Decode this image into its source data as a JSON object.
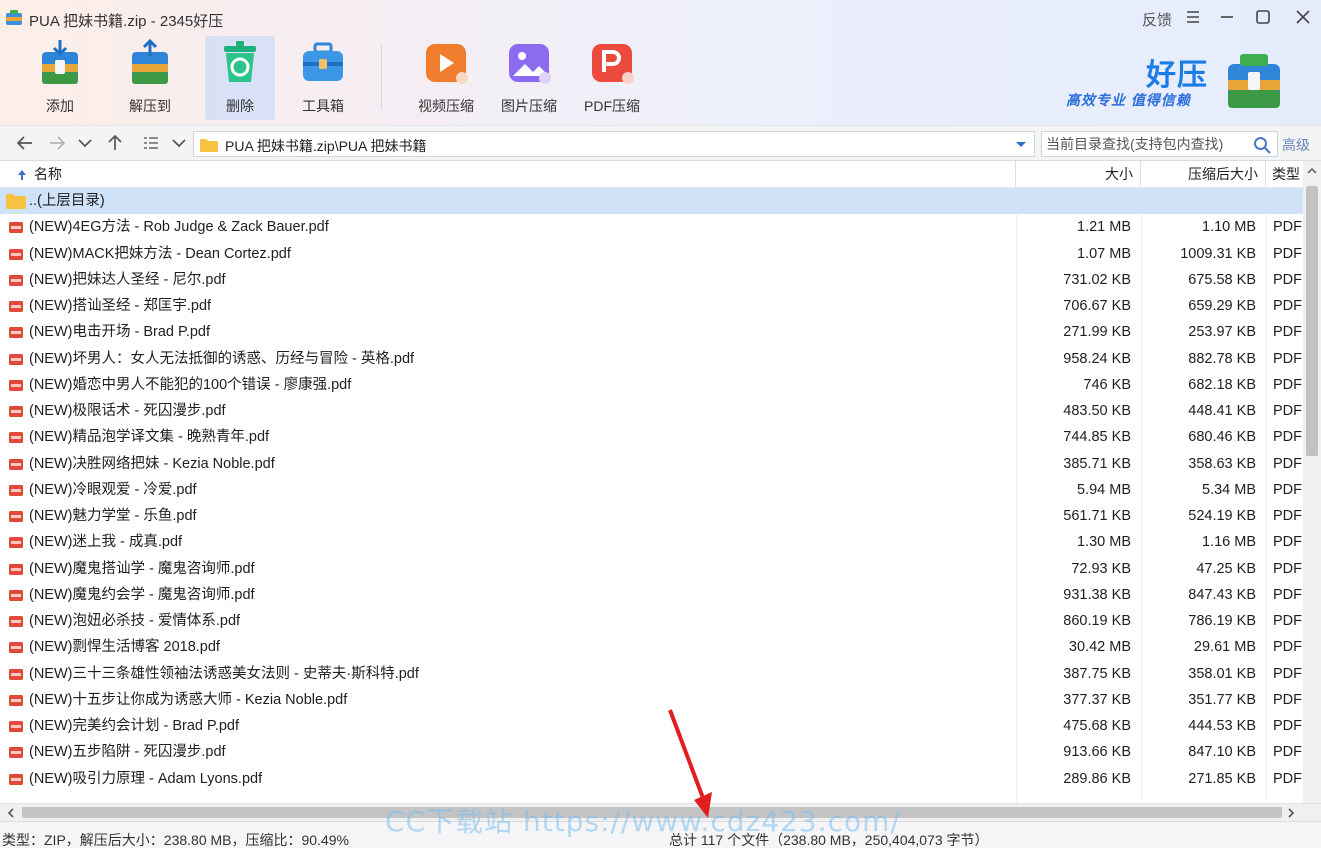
{
  "window": {
    "title": "PUA 把妹书籍.zip - 2345好压",
    "feedback_label": "反馈"
  },
  "toolbar": {
    "items": [
      {
        "label": "添加",
        "icon": "add-archive-icon"
      },
      {
        "label": "解压到",
        "icon": "extract-to-icon"
      },
      {
        "label": "删除",
        "icon": "recycle-delete-icon"
      },
      {
        "label": "工具箱",
        "icon": "toolbox-icon"
      },
      {
        "label": "视频压缩",
        "icon": "video-compress-icon"
      },
      {
        "label": "图片压缩",
        "icon": "image-compress-icon"
      },
      {
        "label": "PDF压缩",
        "icon": "pdf-compress-icon"
      }
    ]
  },
  "brand": {
    "name": "好压",
    "slogan": "高效专业  值得信赖"
  },
  "address": {
    "path": "PUA 把妹书籍.zip\\PUA 把妹书籍",
    "search_placeholder": "当前目录查找(支持包内查找)",
    "advanced_label": "高级"
  },
  "columns": {
    "name": "名称",
    "size": "大小",
    "compressed": "压缩后大小",
    "type": "类型"
  },
  "parent_row": "..(上层目录)",
  "files": [
    {
      "name": "(NEW)4EG方法 - Rob Judge & Zack Bauer.pdf",
      "size": "1.21 MB",
      "compressed": "1.10 MB",
      "type": "PDF"
    },
    {
      "name": "(NEW)MACK把妹方法 - Dean Cortez.pdf",
      "size": "1.07 MB",
      "compressed": "1009.31 KB",
      "type": "PDF"
    },
    {
      "name": "(NEW)把妹达人圣经 - 尼尔.pdf",
      "size": "731.02 KB",
      "compressed": "675.58 KB",
      "type": "PDF"
    },
    {
      "name": "(NEW)搭讪圣经 - 郑匡宇.pdf",
      "size": "706.67 KB",
      "compressed": "659.29 KB",
      "type": "PDF"
    },
    {
      "name": "(NEW)电击开场 - Brad P.pdf",
      "size": "271.99 KB",
      "compressed": "253.97 KB",
      "type": "PDF"
    },
    {
      "name": "(NEW)坏男人：女人无法抵御的诱惑、历经与冒险 - 英格.pdf",
      "size": "958.24 KB",
      "compressed": "882.78 KB",
      "type": "PDF"
    },
    {
      "name": "(NEW)婚恋中男人不能犯的100个错误 - 廖康强.pdf",
      "size": "746 KB",
      "compressed": "682.18 KB",
      "type": "PDF"
    },
    {
      "name": "(NEW)极限话术 - 死囚漫步.pdf",
      "size": "483.50 KB",
      "compressed": "448.41 KB",
      "type": "PDF"
    },
    {
      "name": "(NEW)精品泡学译文集 - 晚熟青年.pdf",
      "size": "744.85 KB",
      "compressed": "680.46 KB",
      "type": "PDF"
    },
    {
      "name": "(NEW)决胜网络把妹 - Kezia Noble.pdf",
      "size": "385.71 KB",
      "compressed": "358.63 KB",
      "type": "PDF"
    },
    {
      "name": "(NEW)冷眼观爱 - 冷爱.pdf",
      "size": "5.94 MB",
      "compressed": "5.34 MB",
      "type": "PDF"
    },
    {
      "name": "(NEW)魅力学堂 - 乐鱼.pdf",
      "size": "561.71 KB",
      "compressed": "524.19 KB",
      "type": "PDF"
    },
    {
      "name": "(NEW)迷上我 - 成真.pdf",
      "size": "1.30 MB",
      "compressed": "1.16 MB",
      "type": "PDF"
    },
    {
      "name": "(NEW)魔鬼搭讪学 - 魔鬼咨询师.pdf",
      "size": "72.93 KB",
      "compressed": "47.25 KB",
      "type": "PDF"
    },
    {
      "name": "(NEW)魔鬼约会学 - 魔鬼咨询师.pdf",
      "size": "931.38 KB",
      "compressed": "847.43 KB",
      "type": "PDF"
    },
    {
      "name": "(NEW)泡妞必杀技 - 爱情体系.pdf",
      "size": "860.19 KB",
      "compressed": "786.19 KB",
      "type": "PDF"
    },
    {
      "name": "(NEW)剽悍生活博客 2018.pdf",
      "size": "30.42 MB",
      "compressed": "29.61 MB",
      "type": "PDF"
    },
    {
      "name": "(NEW)三十三条雄性领袖法诱惑美女法则 - 史蒂夫·斯科特.pdf",
      "size": "387.75 KB",
      "compressed": "358.01 KB",
      "type": "PDF"
    },
    {
      "name": "(NEW)十五步让你成为诱惑大师 - Kezia Noble.pdf",
      "size": "377.37 KB",
      "compressed": "351.77 KB",
      "type": "PDF"
    },
    {
      "name": "(NEW)完美约会计划 - Brad P.pdf",
      "size": "475.68 KB",
      "compressed": "444.53 KB",
      "type": "PDF"
    },
    {
      "name": "(NEW)五步陷阱 - 死囚漫步.pdf",
      "size": "913.66 KB",
      "compressed": "847.10 KB",
      "type": "PDF"
    },
    {
      "name": "(NEW)吸引力原理 - Adam Lyons.pdf",
      "size": "289.86 KB",
      "compressed": "271.85 KB",
      "type": "PDF"
    }
  ],
  "status": {
    "left": "类型：ZIP，解压后大小：238.80 MB，压缩比：90.49%",
    "right": "总计 117 个文件（238.80 MB，250,404,073 字节）"
  },
  "watermark": "CC下载站 https://www.cdz423.com/",
  "colors": {
    "selection": "#cfe2f8",
    "pdf_icon": "#e04a3a",
    "brand": "#1b7ce6",
    "arrow": "#e02020"
  }
}
